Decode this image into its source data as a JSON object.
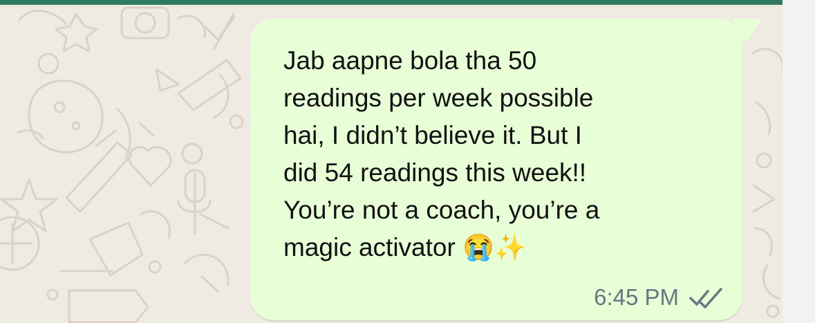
{
  "conversation": {
    "message": {
      "text": "Jab aapne bola tha 50\nreadings per week possible\nhai, I didn’t believe it. But I\ndid 54 readings this week!!\nYou’re not a coach, you’re a\nmagic activator 😭✨",
      "time": "6:45 PM",
      "status_icon": "double-check-icon",
      "read": true
    }
  },
  "colors": {
    "header": "#2f7b62",
    "chat_background": "#efeae2",
    "outgoing_bubble": "#e7fed7",
    "message_text": "#111111",
    "meta_text": "#667781"
  }
}
